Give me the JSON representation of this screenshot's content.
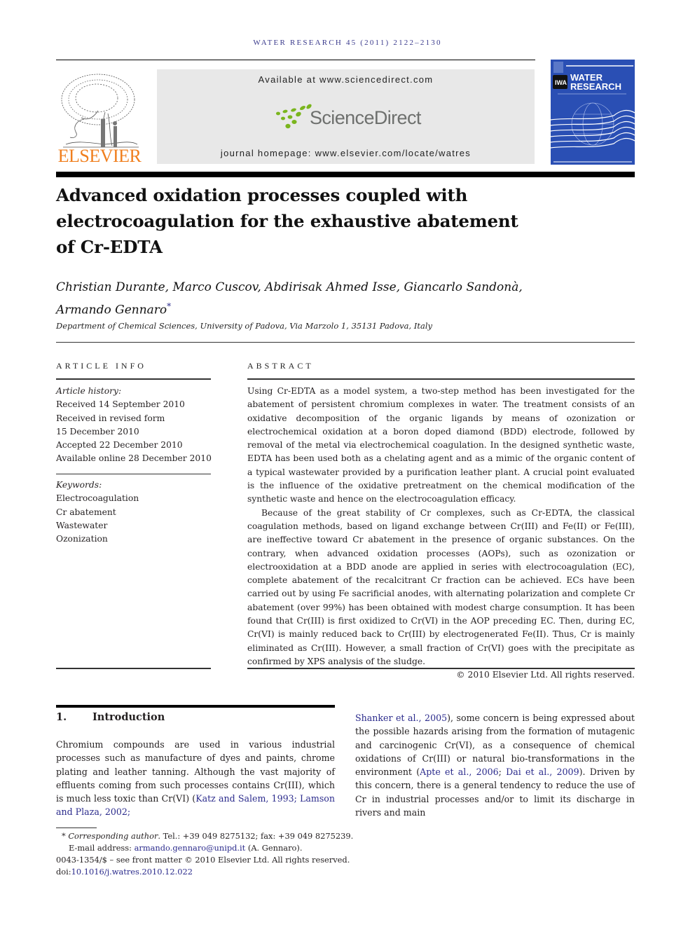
{
  "header": {
    "running_head": "WATER RESEARCH 45 (2011) 2122–2130",
    "publisher_logo_text": "ELSEVIER",
    "available_at": "Available at www.sciencedirect.com",
    "sciencedirect_name": "ScienceDirect",
    "journal_homepage": "journal homepage: www.elsevier.com/locate/watres",
    "cover": {
      "title_line1": "WATER",
      "title_line2": "RESEARCH",
      "badge": "IWA",
      "colors": {
        "background": "#2a4fb4",
        "text": "#ffffff"
      }
    }
  },
  "article": {
    "title": "Advanced oxidation processes coupled with electrocoagulation for the exhaustive abatement of Cr-EDTA",
    "title_lines": [
      "Advanced oxidation processes coupled with",
      "electrocoagulation for the exhaustive abatement",
      "of Cr-EDTA"
    ],
    "authors_line1": "Christian Durante, Marco Cuscov, Abdirisak Ahmed Isse, Giancarlo Sandonà,",
    "authors_line2": "Armando Gennaro",
    "corresponding_mark": "*",
    "affiliation": "Department of Chemical Sciences, University of Padova, Via Marzolo 1, 35131 Padova, Italy"
  },
  "article_info": {
    "heading": "ARTICLE INFO",
    "history_label": "Article history:",
    "history": [
      "Received 14 September 2010",
      "Received in revised form",
      "15 December 2010",
      "Accepted 22 December 2010",
      "Available online 28 December 2010"
    ],
    "keywords_label": "Keywords:",
    "keywords": [
      "Electrocoagulation",
      "Cr abatement",
      "Wastewater",
      "Ozonization"
    ]
  },
  "abstract": {
    "heading": "ABSTRACT",
    "paragraph1": "Using Cr-EDTA as a model system, a two-step method has been investigated for the abatement of persistent chromium complexes in water. The treatment consists of an oxidative decomposition of the organic ligands by means of ozonization or electrochemical oxidation at a boron doped diamond (BDD) electrode, followed by removal of the metal via electrochemical coagulation. In the designed synthetic waste, EDTA has been used both as a chelating agent and as a mimic of the organic content of a typical wastewater provided by a purification leather plant. A crucial point evaluated is the influence of the oxidative pretreatment on the chemical modification of the synthetic waste and hence on the electrocoagulation efficacy.",
    "paragraph2": "Because of the great stability of Cr complexes, such as Cr-EDTA, the classical coagulation methods, based on ligand exchange between Cr(III) and Fe(II) or Fe(III), are ineffective toward Cr abatement in the presence of organic substances. On the contrary, when advanced oxidation processes (AOPs), such as ozonization or electrooxidation at a BDD anode are applied in series with electrocoagulation (EC), complete abatement of the recalcitrant Cr fraction can be achieved. ECs have been carried out by using Fe sacrificial anodes, with alternating polarization and complete Cr abatement (over 99%) has been obtained with modest charge consumption. It has been found that Cr(III) is first oxidized to Cr(VI) in the AOP preceding EC. Then, during EC, Cr(VI) is mainly reduced back to Cr(III) by electrogenerated Fe(II). Thus, Cr is mainly eliminated as Cr(III). However, a small fraction of Cr(VI) goes with the precipitate as confirmed by XPS analysis of the sludge.",
    "copyright": "© 2010 Elsevier Ltd. All rights reserved."
  },
  "introduction": {
    "number": "1.",
    "heading": "Introduction",
    "left_text": "Chromium compounds are used in various industrial processes such as manufacture of dyes and paints, chrome plating and leather tanning. Although the vast majority of effluents coming from such processes contains Cr(III), which is much less toxic than Cr(VI) (",
    "left_cite": "Katz and Salem, 1993; Lamson and Plaza, 2002;",
    "right_cite1": "Shanker et al., 2005",
    "right_text1": "), some concern is being expressed about the possible hazards arising from the formation of mutagenic and carcinogenic Cr(VI), as a consequence of chemical oxidations of Cr(III) or natural bio-transformations in the environment (",
    "right_cite2": "Apte et al., 2006",
    "right_sep": "; ",
    "right_cite3": "Dai et al., 2009",
    "right_text2": "). Driven by this concern, there is a general tendency to reduce the use of Cr in industrial processes and/or to limit its discharge in rivers and main"
  },
  "footnotes": {
    "star": "*",
    "corresponding_label": "Corresponding author",
    "contact": ". Tel.: +39 049 8275132; fax: +39 049 8275239.",
    "email_label": "E-mail address: ",
    "email": "armando.gennaro@unipd.it",
    "email_suffix": " (A. Gennaro).",
    "issn_line": "0043-1354/$ – see front matter © 2010 Elsevier Ltd. All rights reserved.",
    "doi_label": "doi:",
    "doi": "10.1016/j.watres.2010.12.022"
  },
  "colors": {
    "link": "#2b2b8c",
    "elsevier_orange": "#f07f1e",
    "sciencedirect_green": "#7ab51d",
    "sciencedirect_gray": "#6e706e",
    "header_box": "#e8e8e8"
  }
}
